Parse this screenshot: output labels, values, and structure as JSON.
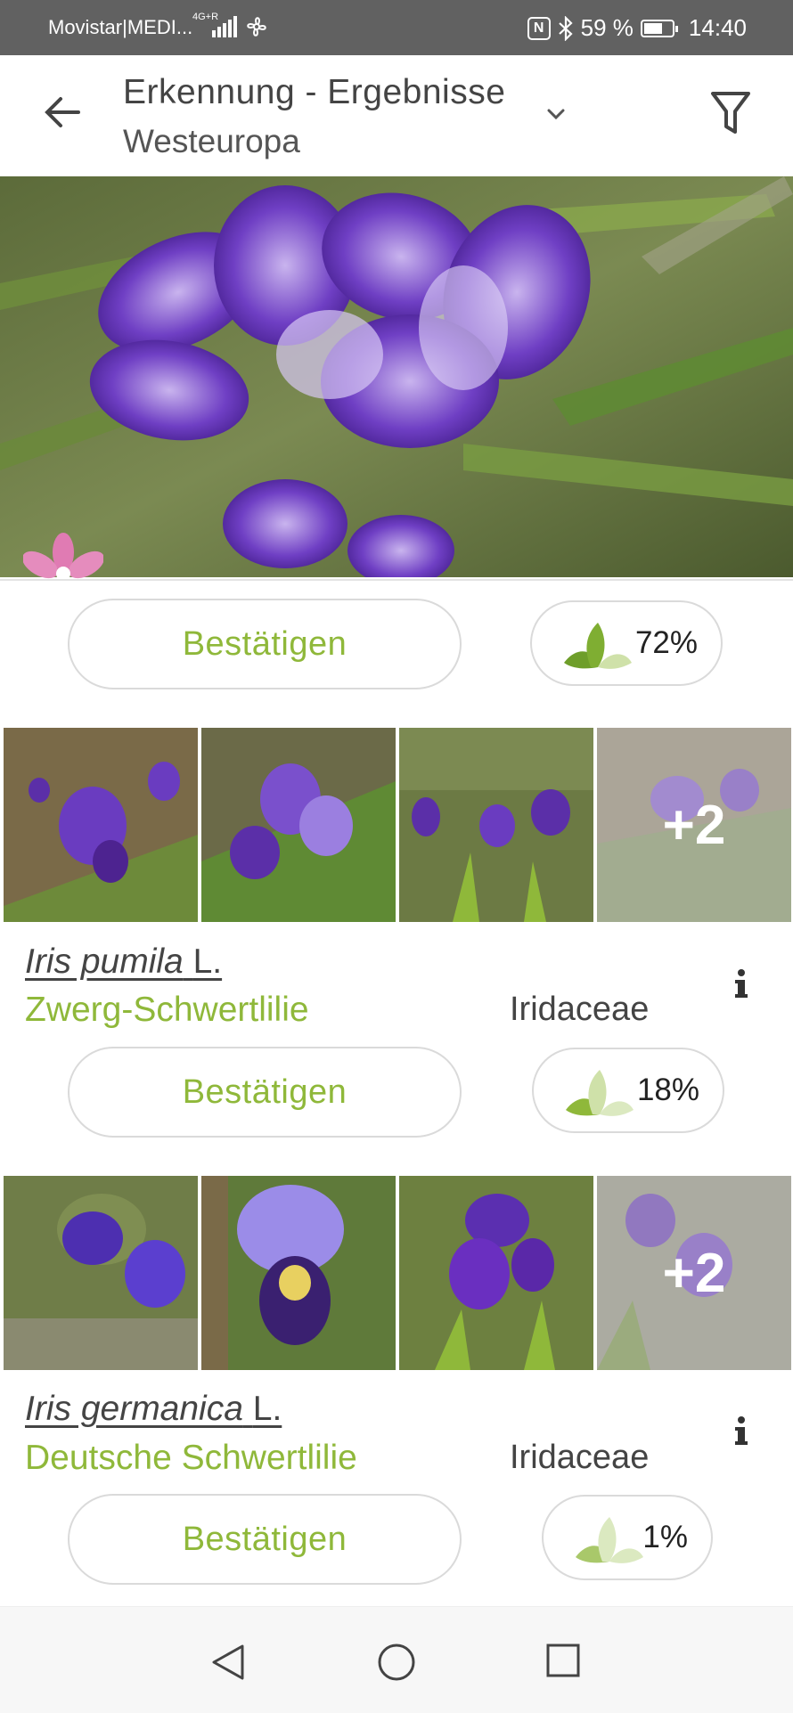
{
  "status_bar": {
    "carrier": "Movistar|MEDI...",
    "network": "4G+R",
    "battery": "59 %",
    "time": "14:40"
  },
  "header": {
    "title": "Erkennung - Ergebnisse",
    "region": "Westeuropa"
  },
  "results": [
    {
      "confirm_label": "Bestätigen",
      "score": "72%",
      "score_fraction": 0.72
    },
    {
      "scientific_genus": "Iris pumila",
      "scientific_author": "L.",
      "common_name": "Zwerg-Schwertlilie",
      "family": "Iridaceae",
      "confirm_label": "Bestätigen",
      "score": "18%",
      "score_fraction": 0.18,
      "more_photos": "+2"
    },
    {
      "scientific_genus": "Iris germanica",
      "scientific_author": "L.",
      "common_name": "Deutsche Schwertlilie",
      "family": "Iridaceae",
      "confirm_label": "Bestätigen",
      "score": "1%",
      "score_fraction": 0.01,
      "more_photos": "+2"
    }
  ],
  "icons": {
    "back": "arrow-left-icon",
    "dropdown": "chevron-down-icon",
    "filter": "filter-icon",
    "info": "info-icon",
    "leaf": "leaf-score-icon",
    "nav_back": "triangle-back-icon",
    "nav_home": "circle-home-icon",
    "nav_recent": "square-recent-icon"
  },
  "colors": {
    "accent_green": "#8fb83a",
    "status_bar": "#616161"
  }
}
